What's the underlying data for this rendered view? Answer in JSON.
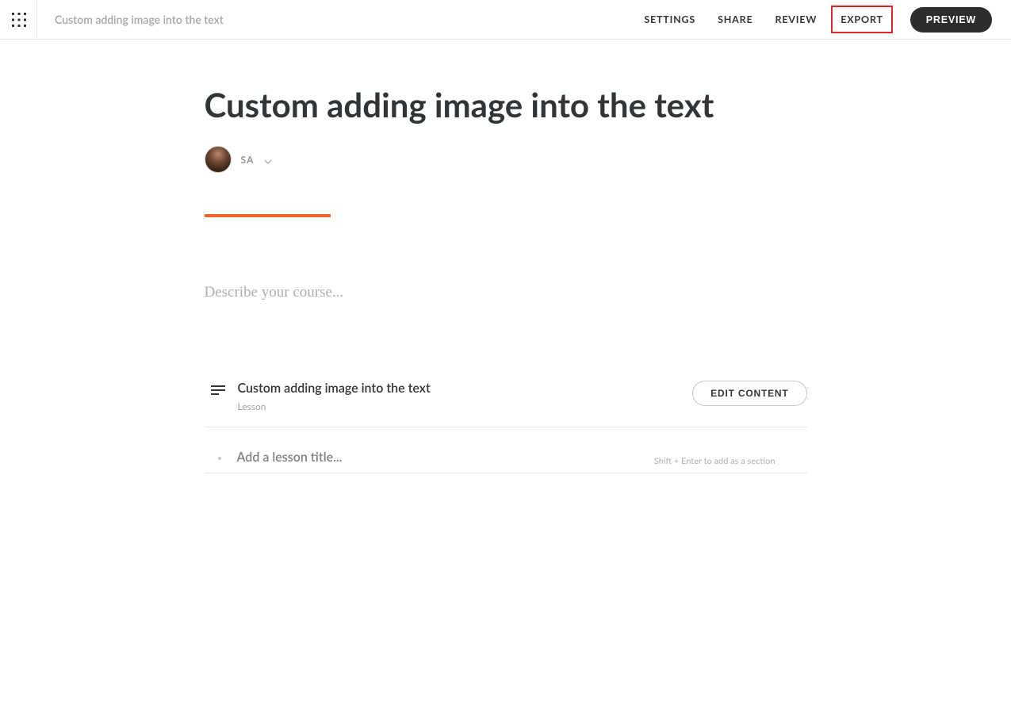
{
  "header": {
    "breadcrumb": "Custom adding image into the text",
    "nav": {
      "settings": "SETTINGS",
      "share": "SHARE",
      "review": "REVIEW",
      "export": "EXPORT",
      "preview": "PREVIEW"
    }
  },
  "main": {
    "title": "Custom adding image into the text",
    "author": {
      "initials": "SA"
    },
    "description_placeholder": "Describe your course...",
    "lesson": {
      "title": "Custom adding image into the text",
      "type": "Lesson",
      "edit_button": "EDIT CONTENT"
    },
    "add_lesson": {
      "placeholder": "Add a lesson title...",
      "hint": "Shift + Enter to add as a section"
    }
  },
  "colors": {
    "accent": "#f26722",
    "highlight_border": "#e1252b"
  }
}
